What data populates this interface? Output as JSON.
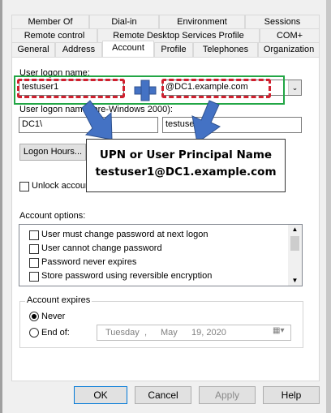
{
  "tabs": {
    "row1": [
      "Member Of",
      "Dial-in",
      "Environment",
      "Sessions"
    ],
    "row2": [
      "Remote control",
      "Remote Desktop Services Profile",
      "COM+"
    ],
    "row3": [
      "General",
      "Address",
      "Account",
      "Profile",
      "Telephones",
      "Organization"
    ]
  },
  "account": {
    "logon_label": "User logon name:",
    "logon_value": "testuser1",
    "domain_value": "@DC1.example.com",
    "pre2000_label": "User logon name (pre-Windows 2000):",
    "pre2000_domain": "DC1\\",
    "pre2000_user": "testuser1",
    "logon_hours_button": "Logon Hours...",
    "unlock_label": "Unlock account",
    "options_label": "Account options:",
    "options": [
      "User must change password at next logon",
      "User cannot change password",
      "Password never expires",
      "Store password using reversible encryption"
    ],
    "expires_label": "Account expires",
    "never_label": "Never",
    "endof_label": "End of:",
    "date": {
      "day": "Tuesday",
      "month": "May",
      "date": "19, 2020"
    }
  },
  "annotation": {
    "line1": "UPN or User Principal Name",
    "line2": "testuser1@DC1.example.com",
    "arrow_color": "#4472c4",
    "dash_color": "#d0202e",
    "box_color": "#22a645"
  },
  "buttons": {
    "ok": "OK",
    "cancel": "Cancel",
    "apply": "Apply",
    "help": "Help"
  }
}
